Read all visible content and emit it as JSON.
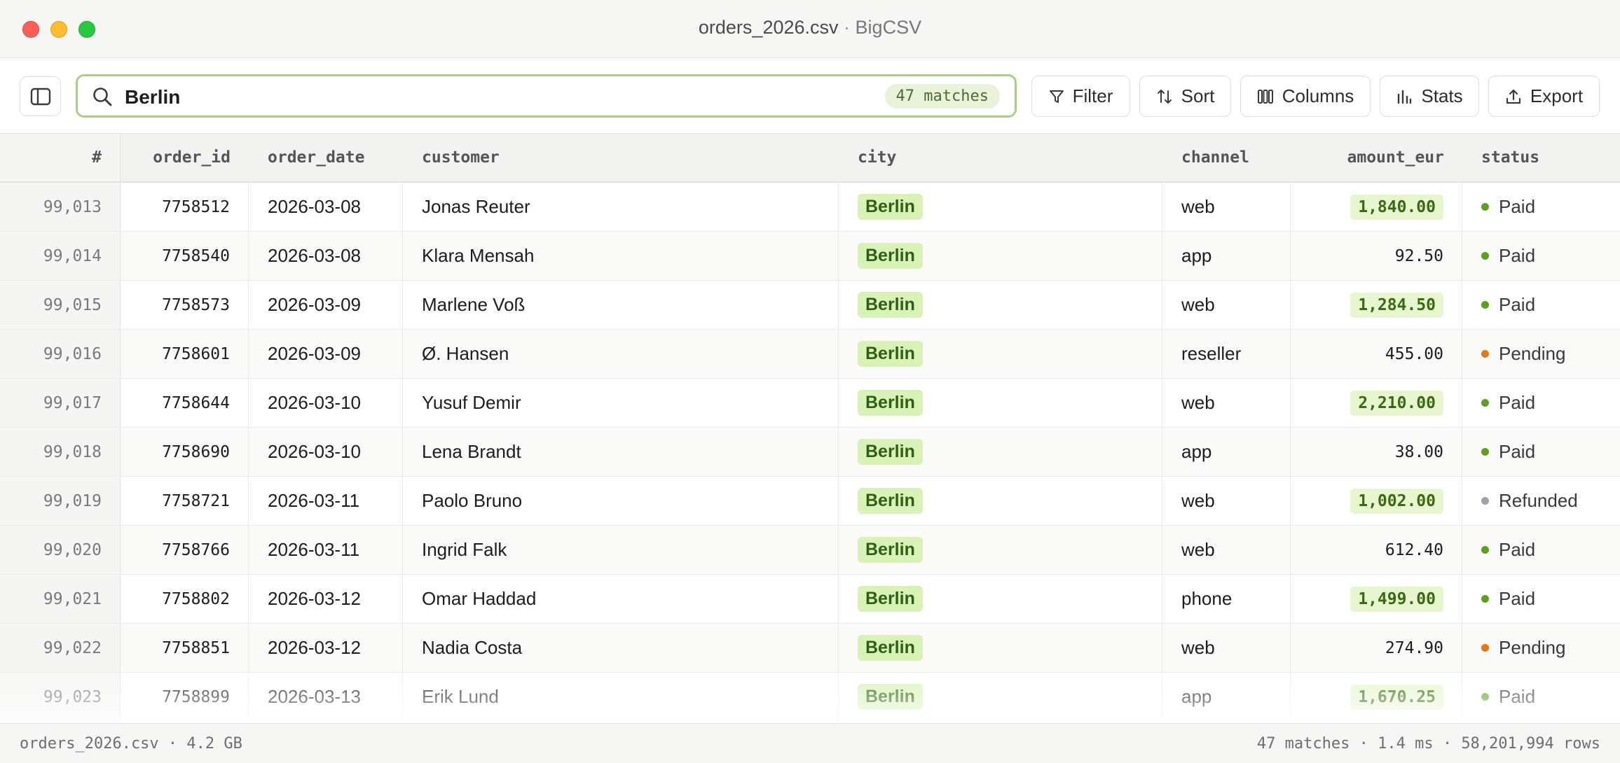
{
  "window": {
    "file_name": "orders_2026.csv",
    "separator": "·",
    "app_name": "BigCSV"
  },
  "search": {
    "value": "Berlin",
    "match_badge": "47 matches"
  },
  "toolbar": {
    "filter": "Filter",
    "sort": "Sort",
    "columns": "Columns",
    "stats": "Stats",
    "export": "Export"
  },
  "icons": {
    "sidebar": "sidebar-toggle-icon",
    "search": "search-icon",
    "filter": "funnel-icon",
    "sort": "sort-arrows-icon",
    "columns": "columns-icon",
    "stats": "bar-chart-icon",
    "export": "upload-icon"
  },
  "colors": {
    "search_border": "#a9cf86",
    "match_highlight": "#d9f2b8",
    "amount_highlight": "#e7f6cf",
    "paid": "#5ba11f",
    "pending": "#e07b16",
    "refunded": "#a0a0a6"
  },
  "table": {
    "headers": {
      "idx": "#",
      "order_id": "order_id",
      "order_date": "order_date",
      "customer": "customer",
      "city": "city",
      "channel": "channel",
      "amount_eur": "amount_eur",
      "status": "status"
    },
    "rows": [
      {
        "idx": "99,013",
        "order_id": "7758512",
        "order_date": "2026-03-08",
        "customer": "Jonas Reuter",
        "city": "Berlin",
        "channel": "web",
        "amount_eur": "1,840.00",
        "highlight": true,
        "status": "Paid",
        "status_kind": "paid"
      },
      {
        "idx": "99,014",
        "order_id": "7758540",
        "order_date": "2026-03-08",
        "customer": "Klara Mensah",
        "city": "Berlin",
        "channel": "app",
        "amount_eur": "92.50",
        "highlight": false,
        "status": "Paid",
        "status_kind": "paid"
      },
      {
        "idx": "99,015",
        "order_id": "7758573",
        "order_date": "2026-03-09",
        "customer": "Marlene Voß",
        "city": "Berlin",
        "channel": "web",
        "amount_eur": "1,284.50",
        "highlight": true,
        "status": "Paid",
        "status_kind": "paid"
      },
      {
        "idx": "99,016",
        "order_id": "7758601",
        "order_date": "2026-03-09",
        "customer": "Ø. Hansen",
        "city": "Berlin",
        "channel": "reseller",
        "amount_eur": "455.00",
        "highlight": false,
        "status": "Pending",
        "status_kind": "pending"
      },
      {
        "idx": "99,017",
        "order_id": "7758644",
        "order_date": "2026-03-10",
        "customer": "Yusuf Demir",
        "city": "Berlin",
        "channel": "web",
        "amount_eur": "2,210.00",
        "highlight": true,
        "status": "Paid",
        "status_kind": "paid"
      },
      {
        "idx": "99,018",
        "order_id": "7758690",
        "order_date": "2026-03-10",
        "customer": "Lena Brandt",
        "city": "Berlin",
        "channel": "app",
        "amount_eur": "38.00",
        "highlight": false,
        "status": "Paid",
        "status_kind": "paid"
      },
      {
        "idx": "99,019",
        "order_id": "7758721",
        "order_date": "2026-03-11",
        "customer": "Paolo Bruno",
        "city": "Berlin",
        "channel": "web",
        "amount_eur": "1,002.00",
        "highlight": true,
        "status": "Refunded",
        "status_kind": "refunded"
      },
      {
        "idx": "99,020",
        "order_id": "7758766",
        "order_date": "2026-03-11",
        "customer": "Ingrid Falk",
        "city": "Berlin",
        "channel": "web",
        "amount_eur": "612.40",
        "highlight": false,
        "status": "Paid",
        "status_kind": "paid"
      },
      {
        "idx": "99,021",
        "order_id": "7758802",
        "order_date": "2026-03-12",
        "customer": "Omar Haddad",
        "city": "Berlin",
        "channel": "phone",
        "amount_eur": "1,499.00",
        "highlight": true,
        "status": "Paid",
        "status_kind": "paid"
      },
      {
        "idx": "99,022",
        "order_id": "7758851",
        "order_date": "2026-03-12",
        "customer": "Nadia Costa",
        "city": "Berlin",
        "channel": "web",
        "amount_eur": "274.90",
        "highlight": false,
        "status": "Pending",
        "status_kind": "pending"
      },
      {
        "idx": "99,023",
        "order_id": "7758899",
        "order_date": "2026-03-13",
        "customer": "Erik Lund",
        "city": "Berlin",
        "channel": "app",
        "amount_eur": "1,670.25",
        "highlight": true,
        "status": "Paid",
        "status_kind": "paid"
      }
    ]
  },
  "statusbar": {
    "file_info": "orders_2026.csv · 4.2 GB",
    "summary": "47 matches · 1.4 ms · 58,201,994 rows"
  }
}
